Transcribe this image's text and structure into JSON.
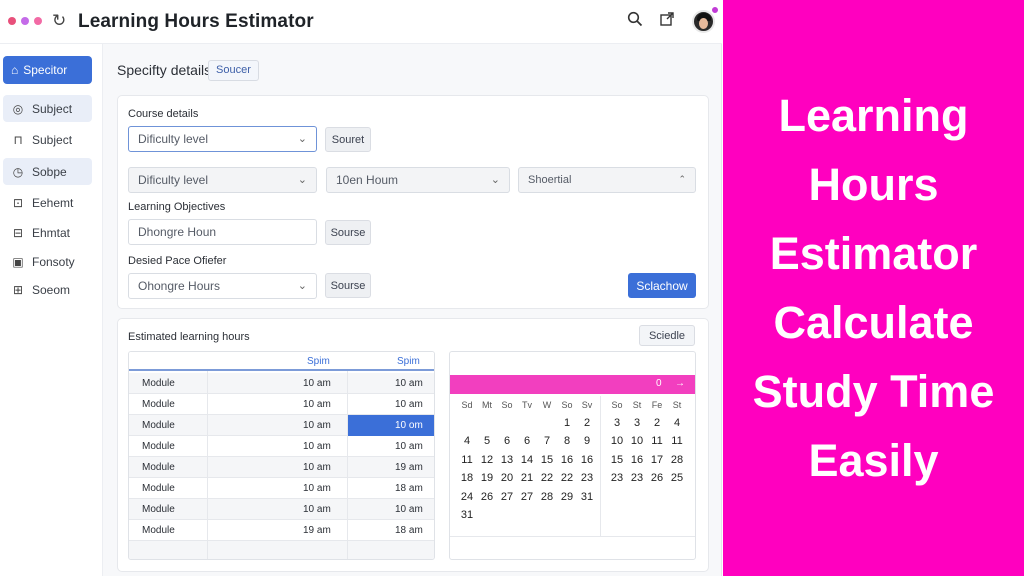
{
  "window": {
    "title": "Learning Hours Estimator",
    "dot_colors": [
      "#e8507b",
      "#c46be8",
      "#f26aa5"
    ]
  },
  "sidebar": {
    "primary_label": "Specitor",
    "items": [
      {
        "label": "Subject",
        "icon": "circle-icon",
        "glyph": "◎",
        "active": true
      },
      {
        "label": "Subject",
        "icon": "lock-icon",
        "glyph": "⊓",
        "active": false
      },
      {
        "label": "Sobpe",
        "icon": "clock-icon",
        "glyph": "◷",
        "active": true
      },
      {
        "label": "Eehemt",
        "icon": "folder-icon",
        "glyph": "⊡",
        "active": false
      },
      {
        "label": "Ehmtat",
        "icon": "list-icon",
        "glyph": "⊟",
        "active": false
      },
      {
        "label": "Fonsoty",
        "icon": "document-icon",
        "glyph": "▣",
        "active": false
      },
      {
        "label": "Soeom",
        "icon": "grid-icon",
        "glyph": "⊞",
        "active": false
      }
    ]
  },
  "header": {
    "breadcrumb": "Specifty details",
    "chip": "Soucer"
  },
  "details": {
    "course_label": "Course details",
    "difficulty_value": "Dificulty level",
    "course_button": "Souret",
    "row2_difficulty": "Dificulty level",
    "row2_hours": "10en Houm",
    "row2_shortlist": "Shoertial",
    "objectives_label": "Learning Objectives",
    "objectives_value": "Dhongre Houn",
    "objectives_button": "Sourse",
    "pace_label": "Desied Pace Ofiefer",
    "pace_value": "Ohongre Hours",
    "pace_button": "Sourse",
    "schedule_button": "Sclachow"
  },
  "estimate": {
    "title": "Estimated learning hours",
    "button": "Sciedle",
    "columns": [
      "Spim",
      "Spim"
    ],
    "rows": [
      {
        "name": "Module",
        "a": "10 am",
        "b": "10 am",
        "highlight": false
      },
      {
        "name": "Module",
        "a": "10 am",
        "b": "10 am",
        "highlight": false
      },
      {
        "name": "Module",
        "a": "10 am",
        "b": "10 om",
        "highlight": true
      },
      {
        "name": "Module",
        "a": "10 am",
        "b": "10 am",
        "highlight": false
      },
      {
        "name": "Module",
        "a": "10 am",
        "b": "19 am",
        "highlight": false
      },
      {
        "name": "Module",
        "a": "10 am",
        "b": "18 am",
        "highlight": false
      },
      {
        "name": "Module",
        "a": "10 am",
        "b": "10 am",
        "highlight": false
      },
      {
        "name": "Module",
        "a": "19 am",
        "b": "18 am",
        "highlight": false
      },
      {
        "name": "",
        "a": "",
        "b": "",
        "highlight": false
      }
    ]
  },
  "calendar": {
    "nav_value": "0",
    "nav_arrow": "→",
    "accent": "#f23fbf",
    "left": {
      "weekdays": [
        "Sd",
        "Mt",
        "So",
        "Tv",
        "W",
        "So",
        "Sv"
      ],
      "weeks": [
        [
          "",
          "",
          "",
          "",
          "",
          "1",
          "2"
        ],
        [
          "4",
          "5",
          "6",
          "6",
          "7",
          "8",
          "9"
        ],
        [
          "11",
          "12",
          "13",
          "14",
          "15",
          "16",
          "16"
        ],
        [
          "18",
          "19",
          "20",
          "21",
          "22",
          "22",
          "23"
        ],
        [
          "24",
          "26",
          "27",
          "27",
          "28",
          "29",
          "31"
        ],
        [
          "31",
          "",
          "",
          "",
          "",
          "",
          ""
        ]
      ]
    },
    "right": {
      "weekdays": [
        "So",
        "St",
        "Fe",
        "St"
      ],
      "weeks": [
        [
          "3",
          "3",
          "2",
          "4"
        ],
        [
          "10",
          "10",
          "11",
          "11"
        ],
        [
          "15",
          "16",
          "17",
          "28"
        ],
        [
          "23",
          "23",
          "26",
          "25"
        ]
      ]
    }
  },
  "promo": {
    "lines": [
      "Learning",
      "Hours",
      "Estimator",
      "Calculate",
      "Study Time",
      "Easily"
    ],
    "background": "#ff00bf"
  }
}
